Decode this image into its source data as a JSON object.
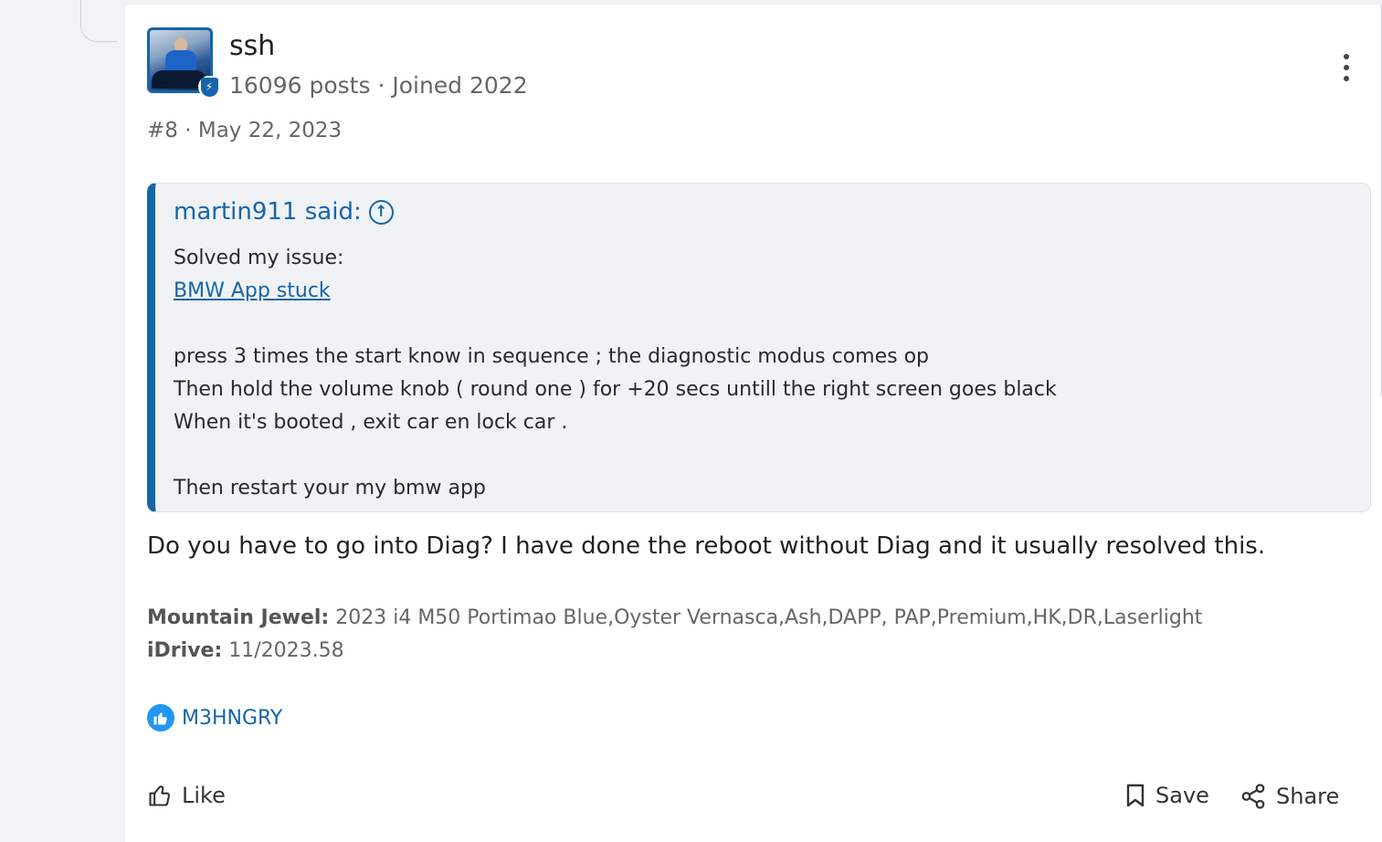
{
  "post": {
    "username": "ssh",
    "post_count": "16096 posts",
    "separator": " · ",
    "joined": "Joined 2022",
    "post_number": "#8",
    "post_date": "May 22, 2023"
  },
  "quote": {
    "author": "martin911 said:",
    "line1": "Solved my issue:",
    "link_text": "BMW App stuck",
    "line3": "press 3 times the start know in sequence ; the diagnostic modus comes op",
    "line4": "Then hold the volume knob ( round one ) for +20 secs untill the right screen goes black",
    "line5": "When it's booted , exit car en lock car .",
    "line6": "Then restart your my bmw app"
  },
  "reply": {
    "text": "Do you have to go into Diag? I have done the reboot without Diag and it usually resolved this."
  },
  "signature": {
    "label1": "Mountain Jewel:",
    "value1": " 2023 i4 M50 Portimao Blue,Oyster Vernasca,Ash,DAPP, PAP,Premium,HK,DR,Laserlight",
    "label2": "iDrive:",
    "value2": " 11/2023.58"
  },
  "reactions": {
    "liked_by": "M3HNGRY"
  },
  "actions": {
    "like": "Like",
    "save": "Save",
    "share": "Share"
  },
  "colors": {
    "accent": "#1565a8",
    "like_blue": "#2196f3",
    "quote_bg": "#f0f2f5"
  }
}
